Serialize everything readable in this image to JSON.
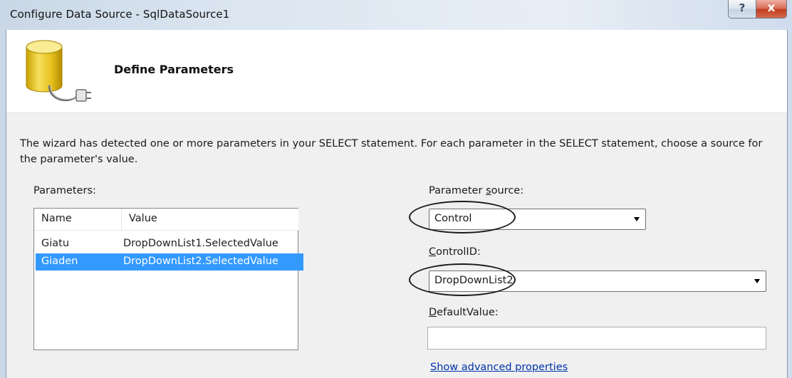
{
  "window": {
    "title": "Configure Data Source - SqlDataSource1",
    "help_glyph": "?",
    "close_glyph": "x"
  },
  "header": {
    "heading": "Define Parameters",
    "icon": "database-connection-icon"
  },
  "body": {
    "description": "The wizard has detected one or more parameters in your SELECT statement. For each parameter in the SELECT statement, choose a source for the parameter's value.",
    "parameters_label": "Parameters:",
    "columns": [
      "Name",
      "Value"
    ],
    "rows": [
      {
        "name": "Giatu",
        "value": "DropDownList1.SelectedValue",
        "selected": false
      },
      {
        "name": "Giaden",
        "value": "DropDownList2.SelectedValue",
        "selected": true
      }
    ],
    "parameter_source_label": "Parameter source:",
    "parameter_source_value": "Control",
    "control_id_label": "ControlID:",
    "control_id_value": "DropDownList2",
    "default_value_label": "DefaultValue:",
    "default_value_value": "",
    "advanced_link": "Show advanced properties"
  },
  "colors": {
    "selection": "#3399ff",
    "link": "#0033aa",
    "close_button": "#c33d1f"
  }
}
